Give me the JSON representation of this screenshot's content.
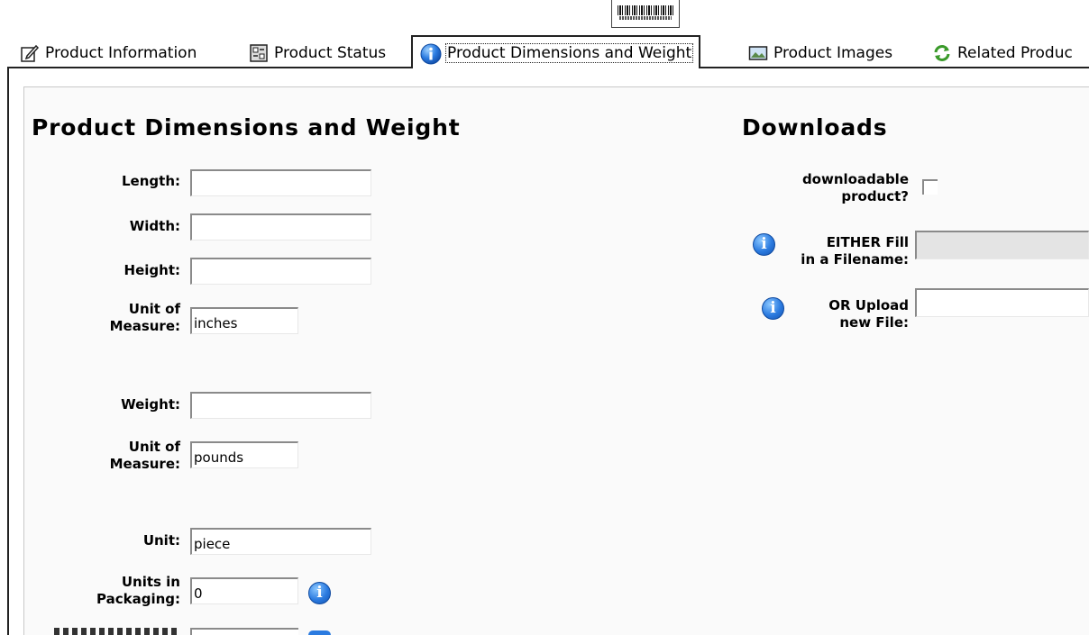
{
  "tabs": [
    {
      "label": "Product Information",
      "icon": "edit-icon"
    },
    {
      "label": "Product Status",
      "icon": "status-icon"
    },
    {
      "label": "Product Dimensions and Weight",
      "icon": "info-icon"
    },
    {
      "label": "Product Images",
      "icon": "image-icon"
    },
    {
      "label": "Related Produc",
      "icon": "refresh-icon"
    }
  ],
  "dimensions": {
    "heading": "Product Dimensions and Weight",
    "length_label": "Length:",
    "length_value": "",
    "width_label": "Width:",
    "width_value": "",
    "height_label": "Height:",
    "height_value": "",
    "size_unit_label_1": "Unit of",
    "size_unit_label_2": "Measure:",
    "size_unit_value": "inches",
    "weight_label": "Weight:",
    "weight_value": "",
    "weight_unit_label_1": "Unit of",
    "weight_unit_label_2": "Measure:",
    "weight_unit_value": "pounds",
    "unit_label": "Unit:",
    "unit_value": "piece",
    "units_pack_label_1": "Units in",
    "units_pack_label_2": "Packaging:",
    "units_pack_value": "0"
  },
  "downloads": {
    "heading": "Downloads",
    "downloadable_label_1": "downloadable",
    "downloadable_label_2": "product?",
    "filename_label_1": "EITHER Fill",
    "filename_label_2": "in a Filename:",
    "upload_label_1": "OR Upload",
    "upload_label_2": "new File:"
  },
  "colors": {
    "info_icon": "#2b7be0",
    "active_tab_border": "#222222",
    "panel_bg": "#fafafa"
  }
}
